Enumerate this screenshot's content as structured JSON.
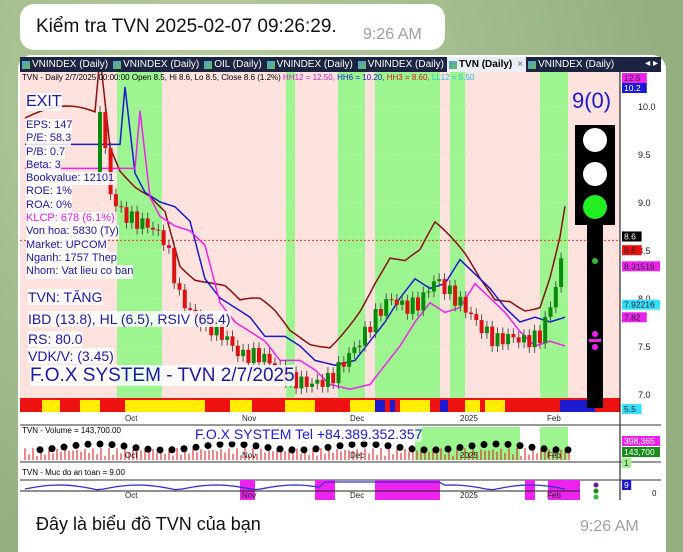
{
  "messages": [
    {
      "text": "Kiểm tra TVN 2025-02-07 09:26:29.",
      "time": "9:26 AM"
    },
    {
      "caption": "Đây là biểu đồ TVN của bạn",
      "time": "9:26 AM"
    }
  ],
  "chart": {
    "tabs": [
      {
        "label": "VNINDEX (Daily)"
      },
      {
        "label": "VNINDEX (Daily)"
      },
      {
        "label": "OIL (Daily)"
      },
      {
        "label": "VNINDEX (Daily)"
      },
      {
        "label": "VNINDEX (Daily)"
      },
      {
        "label": "TVN (Daily)",
        "active": true
      },
      {
        "label": "VNINDEX (Daily)"
      }
    ],
    "tab_close": "×",
    "tab_arrows": "◂ ▸",
    "info": {
      "base": "TVN - Daily 2/7/2025 00:00:00 Open 8.5, Hi 8.6, Lo 8.5, Close 8.6 (1.2%)",
      "hh12": "HH12 = 12.50,",
      "hh6": "HH6 = 10.20,",
      "hh3": "HH3 = 8.60,",
      "ll12": "LL12 = 5.50"
    },
    "signal": "EXIT",
    "stats": [
      "EPS: 147",
      "P/E: 58.3",
      "P/B: 0.7",
      "Beta: 3",
      "Bookvalue: 12101",
      "ROE: 1%",
      "ROA: 0%",
      "KLCP: 678 (6.1%)",
      "Von hoa: 5830 (Ty)",
      "Market: UPCOM",
      "Nganh: 1757 Thep",
      "Nhom: Vat lieu co ban"
    ],
    "trend": "TVN: TĂNG",
    "indicators": "IBD (13.8), HL (6.5), RSIV (65.4)",
    "rs": "RS: 80.0",
    "vdk": "VDK/V:  (3.45)",
    "watermark": "F.O.X SYSTEM - TVN 2/7/2025",
    "score": "9(0)",
    "price_axis": [
      "10.0",
      "9.5",
      "9.0",
      "8.5",
      "8.0",
      "7.5",
      "7.0"
    ],
    "price_tags": {
      "hh12": "12.5",
      "hh6": "10.2",
      "close": "8.6",
      "hh3": "8.6",
      "ma1": "8.31518",
      "ma2": "7.92216",
      "ma3": "7.82",
      "ll12": "5.5"
    },
    "time_axis": [
      "Oct",
      "Nov",
      "Dec",
      "2025",
      "Feb"
    ],
    "volume": {
      "label": "TVN - Volume = 143,700.00",
      "ad": "F.O.X SYSTEM Tel +84.389.352.357",
      "tag1": "398,365",
      "tag2": "143,700",
      "tag3": "1"
    },
    "safety": {
      "label": "TVN - Muc do an toan = 9.00",
      "tag": "9",
      "axis": "0"
    },
    "colors": {
      "green_light": "#9df58f",
      "pink_bg": "#fde2de",
      "red": "#ee1111",
      "blue": "#1a1ad0",
      "magenta": "#ee22ee",
      "cyan": "#33e0ff"
    }
  }
}
